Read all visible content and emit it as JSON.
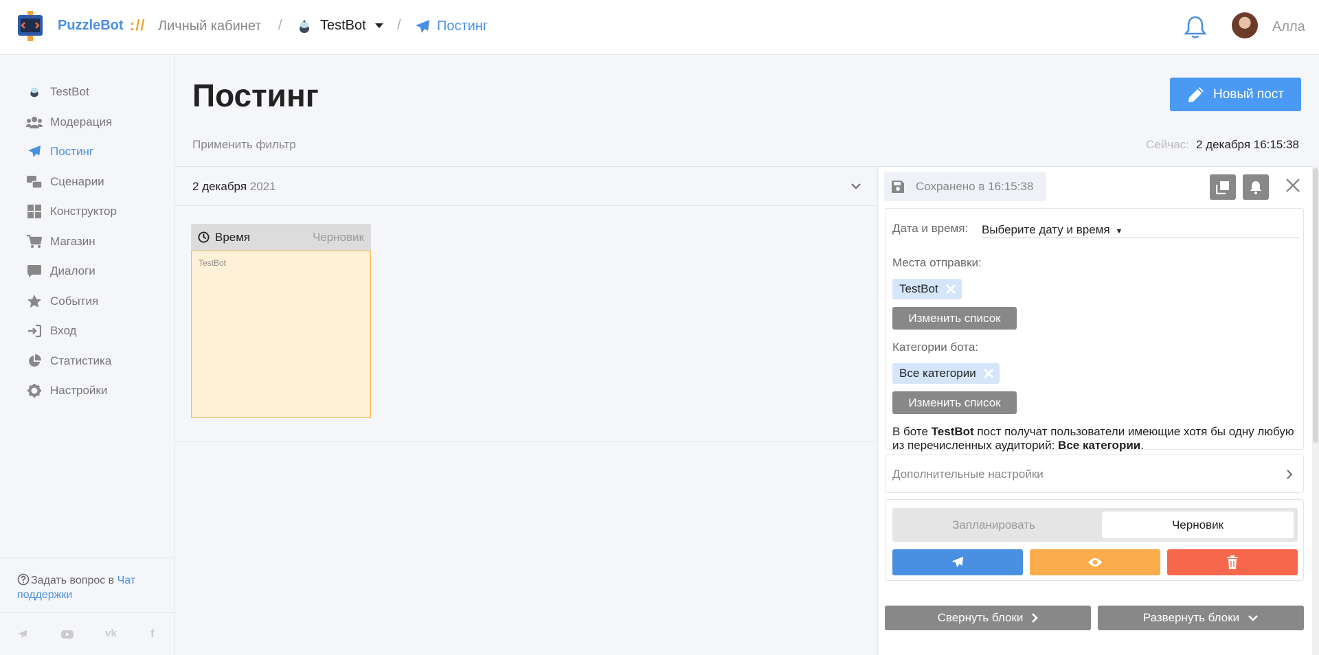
{
  "header": {
    "brand": "PuzzleBot",
    "brand_slashes": "://",
    "breadcrumb_cabinet": "Личный кабинет",
    "breadcrumb_sep": "/",
    "breadcrumb_bot": "TestBot",
    "breadcrumb_page": "Постинг",
    "username": "Алла",
    "icons": [
      "logo-icon",
      "bot-icon",
      "paper-plane-icon",
      "bell-icon",
      "avatar"
    ]
  },
  "sidebar": {
    "items": [
      {
        "label": "TestBot",
        "icon": "bot-icon",
        "active": false
      },
      {
        "label": "Модерация",
        "icon": "users-icon",
        "active": false
      },
      {
        "label": "Постинг",
        "icon": "paper-plane-icon",
        "active": true
      },
      {
        "label": "Сценарии",
        "icon": "scenarios-icon",
        "active": false
      },
      {
        "label": "Конструктор",
        "icon": "grid-icon",
        "active": false
      },
      {
        "label": "Магазин",
        "icon": "cart-icon",
        "active": false
      },
      {
        "label": "Диалоги",
        "icon": "chat-icon",
        "active": false
      },
      {
        "label": "События",
        "icon": "star-icon",
        "active": false
      },
      {
        "label": "Вход",
        "icon": "sign-in-icon",
        "active": false
      },
      {
        "label": "Статистика",
        "icon": "pie-chart-icon",
        "active": false
      },
      {
        "label": "Настройки",
        "icon": "gear-icon",
        "active": false
      }
    ],
    "help_prefix": "Задать вопрос в",
    "help_link": "Чат поддержки",
    "social": [
      "telegram-icon",
      "youtube-icon",
      "vk-icon",
      "facebook-icon"
    ],
    "social_text": {
      "telegram": "",
      "youtube": "",
      "vk": "vk",
      "facebook": "f"
    }
  },
  "main": {
    "title": "Постинг",
    "new_post_label": "Новый пост",
    "filter_label": "Применить фильтр",
    "now_label": "Сейчас:",
    "now_value": "2 декабря 16:15:38",
    "date_day": "2 декабря",
    "date_year": "2021",
    "post_card": {
      "time_label": "Время",
      "status": "Черновик",
      "bot": "TestBot"
    }
  },
  "editor": {
    "saved_text": "Сохранено в 16:15:38",
    "datetime_label": "Дата и время:",
    "datetime_value": "Выберите дату и время",
    "dest_label": "Места отправки:",
    "dest_chip": "TestBot",
    "change_list_label": "Изменить список",
    "categories_label": "Категории бота:",
    "categories_chip": "Все категории",
    "audience_prefix": "В боте",
    "audience_bot": "TestBot",
    "audience_middle": "пост получат пользователи имеющие хотя бы одну любую из перечисленных аудиторий:",
    "audience_cats": "Все категории",
    "audience_end": ".",
    "advanced_label": "Дополнительные настройки",
    "toggle_schedule": "Запланировать",
    "toggle_draft": "Черновик",
    "collapse_label": "Свернуть блоки",
    "expand_label": "Развернуть блоки"
  },
  "colors": {
    "accent": "#4a90e2",
    "primary_button": "#4a9af3",
    "send": "#4a90e2",
    "preview": "#fbad4c",
    "delete": "#f7674c",
    "draft_bg": "#fff1d8",
    "draft_border": "#f3b84f"
  }
}
